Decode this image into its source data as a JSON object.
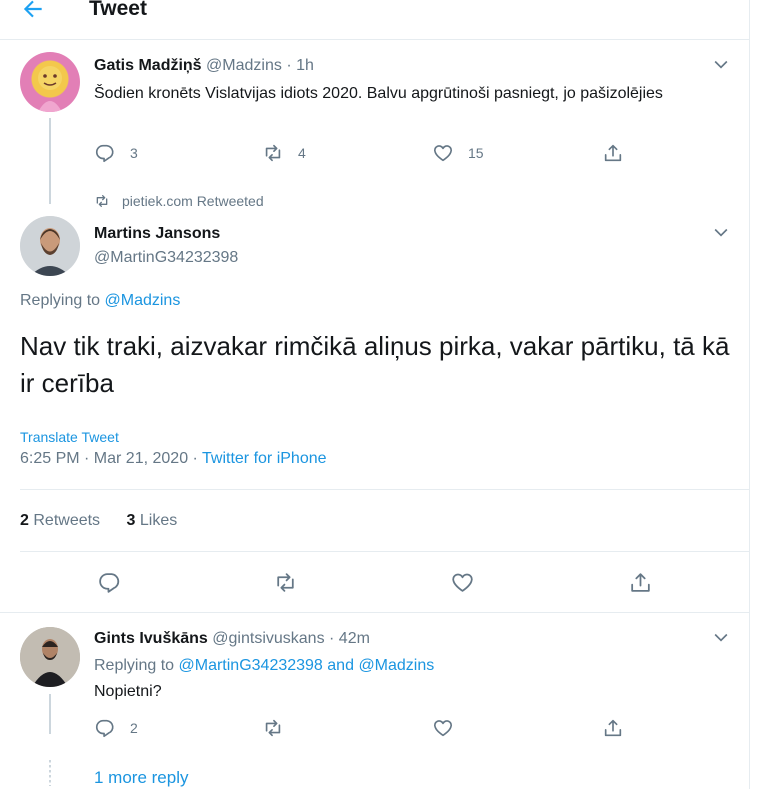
{
  "header": {
    "title": "Tweet"
  },
  "tweet1": {
    "name": "Gatis Madžiņš",
    "handle": "@Madzins",
    "time": "· 1h",
    "text": "Šodien kronēts Vislatvijas idiots 2020. Balvu apgrūtinoši pasniegt, jo pašizolējies",
    "replies": "3",
    "retweets": "4",
    "likes": "15"
  },
  "retweet_note": "pietiek.com Retweeted",
  "main": {
    "name": "Martins Jansons",
    "handle": "@MartinG34232398",
    "replying_prefix": "Replying to",
    "replying_to": "@Madzins",
    "text": "Nav tik traki, aizvakar rimčikā aliņus pirka, vakar pārtiku, tā kā ir cerība",
    "translate": "Translate Tweet",
    "timestamp": "6:25 PM · Mar 21, 2020 ·",
    "source": "Twitter for iPhone",
    "retweet_count": "2",
    "retweet_label": "Retweets",
    "like_count": "3",
    "like_label": "Likes"
  },
  "reply": {
    "name": "Gints Ivuškāns",
    "handle": "@gintsivuskans",
    "time": "· 42m",
    "replying_prefix": "Replying to",
    "replying_to_1": "@MartinG34232398",
    "and": "and",
    "replying_to_2": "@Madzins",
    "text": "Nopietni?",
    "replies": "2"
  },
  "more_reply": "1 more reply",
  "colors": {
    "accent": "#1da1f2",
    "link": "#1b95e0",
    "muted": "#657786",
    "border": "#e6ecf0"
  }
}
